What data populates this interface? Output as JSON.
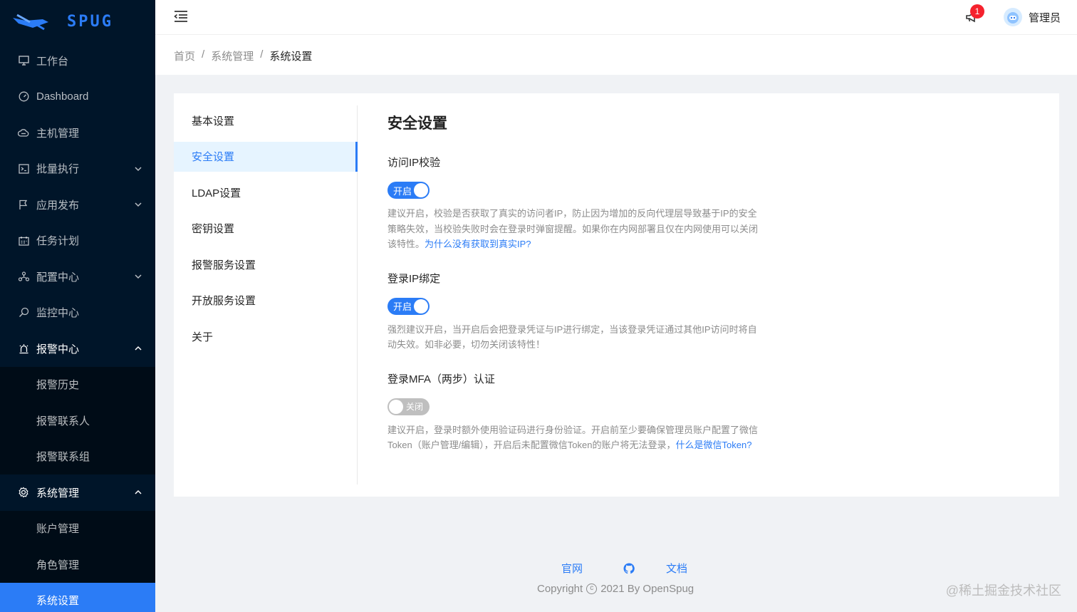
{
  "app": {
    "logo_text": "SPUG",
    "brand_color": "#2b7cf6"
  },
  "sidebar": {
    "items": [
      {
        "label": "工作台",
        "icon": "desktop-icon"
      },
      {
        "label": "Dashboard",
        "icon": "dashboard-icon"
      },
      {
        "label": "主机管理",
        "icon": "cloud-server-icon"
      },
      {
        "label": "批量执行",
        "icon": "code-icon",
        "expandable": true
      },
      {
        "label": "应用发布",
        "icon": "flag-icon",
        "expandable": true
      },
      {
        "label": "任务计划",
        "icon": "schedule-icon"
      },
      {
        "label": "配置中心",
        "icon": "deployment-icon",
        "expandable": true
      },
      {
        "label": "监控中心",
        "icon": "monitor-icon"
      },
      {
        "label": "报警中心",
        "icon": "alert-icon",
        "expanded": true
      },
      {
        "label": "报警历史",
        "sub": true
      },
      {
        "label": "报警联系人",
        "sub": true
      },
      {
        "label": "报警联系组",
        "sub": true
      },
      {
        "label": "系统管理",
        "icon": "setting-icon",
        "expanded": true
      },
      {
        "label": "账户管理",
        "sub": true
      },
      {
        "label": "角色管理",
        "sub": true
      },
      {
        "label": "系统设置",
        "sub": true,
        "active": true
      }
    ]
  },
  "header": {
    "notification_count": "1",
    "username": "管理员"
  },
  "breadcrumb": {
    "items": [
      "首页",
      "系统管理"
    ],
    "current": "系统设置",
    "separator": "/"
  },
  "settings": {
    "tabs": [
      "基本设置",
      "安全设置",
      "LDAP设置",
      "密钥设置",
      "报警服务设置",
      "开放服务设置",
      "关于"
    ],
    "active_tab": "安全设置",
    "title": "安全设置",
    "sections": {
      "ip_verify": {
        "title": "访问IP校验",
        "switch_label": "开启",
        "enabled": true,
        "desc": "建议开启，校验是否获取了真实的访问者IP，防止因为增加的反向代理层导致基于IP的安全策略失效，当校验失败时会在登录时弹窗提醒。如果你在内网部署且仅在内网使用可以关闭该特性。",
        "link": "为什么没有获取到真实IP?"
      },
      "ip_bind": {
        "title": "登录IP绑定",
        "switch_label": "开启",
        "enabled": true,
        "desc": "强烈建议开启，当开启后会把登录凭证与IP进行绑定，当该登录凭证通过其他IP访问时将自动失效。如非必要，切勿关闭该特性！"
      },
      "mfa": {
        "title": "登录MFA（两步）认证",
        "switch_label": "关闭",
        "enabled": false,
        "desc": "建议开启，登录时额外使用验证码进行身份验证。开启前至少要确保管理员账户配置了微信Token（账户管理/编辑），开启后未配置微信Token的账户将无法登录，",
        "link": "什么是微信Token?"
      }
    }
  },
  "footer": {
    "link_site": "官网",
    "link_docs": "文档",
    "github_icon": "github-icon",
    "copyright_prefix": "Copyright",
    "copyright_symbol": "c",
    "copyright_text": "2021 By OpenSpug"
  },
  "watermark": "@稀土掘金技术社区"
}
